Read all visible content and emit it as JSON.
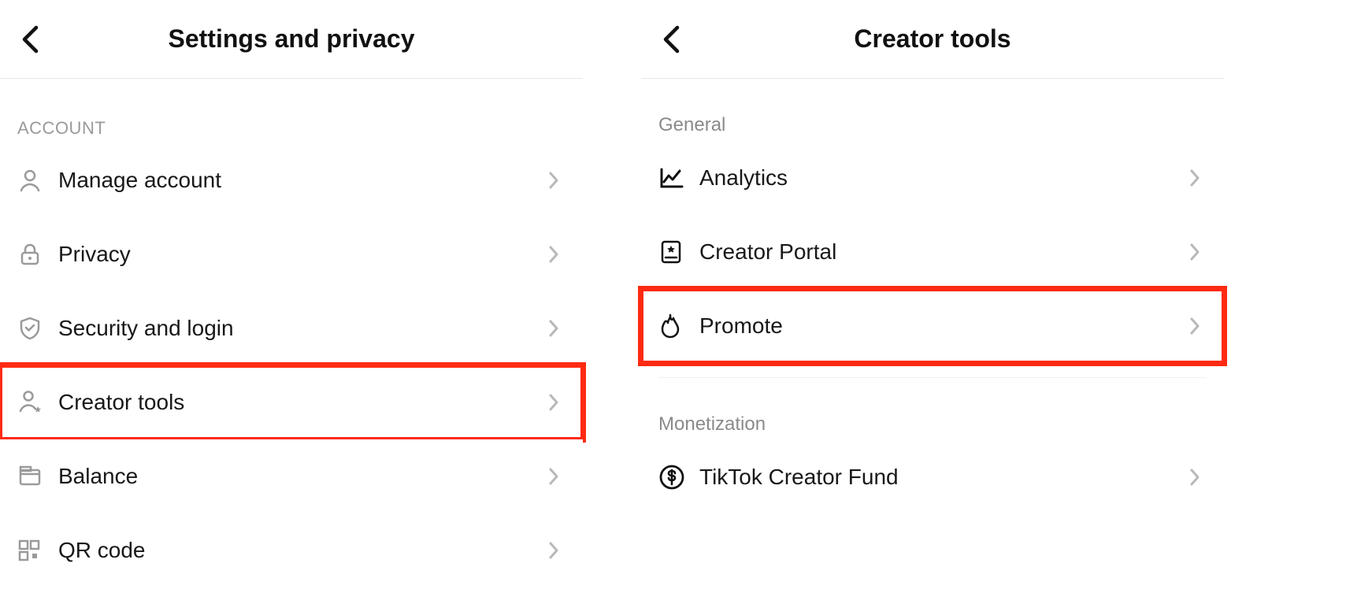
{
  "left": {
    "title": "Settings and privacy",
    "section_account": "ACCOUNT",
    "items": [
      {
        "label": "Manage account",
        "icon": "person-icon"
      },
      {
        "label": "Privacy",
        "icon": "lock-icon"
      },
      {
        "label": "Security and login",
        "icon": "shield-icon"
      },
      {
        "label": "Creator tools",
        "icon": "person-star-icon",
        "highlight": true
      },
      {
        "label": "Balance",
        "icon": "wallet-icon"
      },
      {
        "label": "QR code",
        "icon": "qr-icon"
      }
    ]
  },
  "right": {
    "title": "Creator tools",
    "section_general": "General",
    "section_monetization": "Monetization",
    "general_items": [
      {
        "label": "Analytics",
        "icon": "analytics-icon"
      },
      {
        "label": "Creator Portal",
        "icon": "portal-icon"
      },
      {
        "label": "Promote",
        "icon": "flame-icon",
        "highlight": true
      }
    ],
    "monetization_items": [
      {
        "label": "TikTok Creator Fund",
        "icon": "dollar-icon"
      }
    ]
  }
}
